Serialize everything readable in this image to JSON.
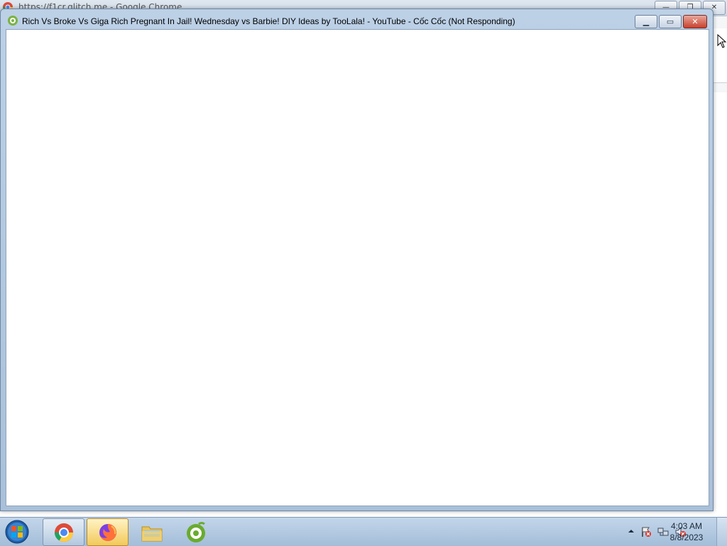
{
  "background_window": {
    "title": "https://f1cr.glitch.me - Google Chrome",
    "controls": [
      "minimize",
      "restore",
      "close"
    ]
  },
  "window": {
    "title": "Rich Vs Broke Vs Giga Rich Pregnant In Jail! Wednesday vs Barbie! DIY Ideas by TooLala! - YouTube - Cốc Cốc (Not Responding)",
    "app_icon": "coccoc-icon",
    "controls": [
      "minimize",
      "maximize",
      "close"
    ]
  },
  "taskbar": {
    "start_icon": "windows-start-icon",
    "apps": [
      {
        "name": "Google Chrome",
        "icon": "chrome-icon",
        "state": "pinned"
      },
      {
        "name": "Firefox",
        "icon": "firefox-icon",
        "state": "active"
      },
      {
        "name": "Windows Explorer",
        "icon": "folder-icon",
        "state": "normal"
      },
      {
        "name": "Cốc Cốc",
        "icon": "coccoc-icon",
        "state": "normal"
      }
    ],
    "tray": {
      "icons": [
        "show-hidden-icons",
        "action-center-flag-icon",
        "network-icon",
        "volume-muted-icon"
      ],
      "time": "4:03 AM",
      "date": "8/8/2023"
    }
  },
  "colors": {
    "taskbar": "#a9c2dc",
    "close_button": "#c8412e",
    "active_app": "#f2c95a"
  }
}
